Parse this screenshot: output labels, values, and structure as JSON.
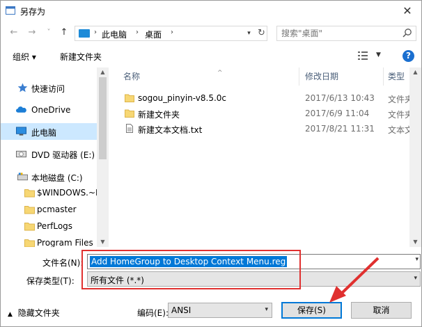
{
  "window": {
    "title": "另存为",
    "close_glyph": "✕"
  },
  "nav": {
    "back_glyph": "←",
    "forward_glyph": "→",
    "recent_glyph": "˅",
    "up_glyph": "↑",
    "breadcrumb": [
      "此电脑",
      "桌面"
    ],
    "sep_glyph": "›",
    "refresh_glyph": "↻",
    "search_placeholder": "搜索\"桌面\""
  },
  "toolbar": {
    "organize": "组织 ▾",
    "new_folder": "新建文件夹",
    "help": "?"
  },
  "sidebar": {
    "items": [
      {
        "label": "快速访问",
        "icon": "star-icon"
      },
      {
        "label": "OneDrive",
        "icon": "cloud-icon"
      },
      {
        "label": "此电脑",
        "icon": "computer-icon",
        "selected": true
      },
      {
        "label": "DVD 驱动器 (E:) (",
        "icon": "dvd-icon"
      },
      {
        "label": "本地磁盘 (C:)",
        "icon": "disk-icon"
      },
      {
        "label": "$WINDOWS.~B",
        "icon": "folder-icon"
      },
      {
        "label": "pcmaster",
        "icon": "folder-icon"
      },
      {
        "label": "PerfLogs",
        "icon": "folder-icon"
      },
      {
        "label": "Program Files",
        "icon": "folder-icon"
      }
    ]
  },
  "files": {
    "columns": {
      "name": "名称",
      "date": "修改日期",
      "type": "类型"
    },
    "rows": [
      {
        "name": "sogou_pinyin-v8.5.0c",
        "date": "2017/6/13 10:43",
        "type": "文件夹",
        "icon": "folder-icon"
      },
      {
        "name": "新建文件夹",
        "date": "2017/6/9 11:04",
        "type": "文件夹",
        "icon": "folder-icon"
      },
      {
        "name": "新建文本文档.txt",
        "date": "2017/8/21 11:31",
        "type": "文本文档",
        "icon": "text-file-icon"
      }
    ]
  },
  "form": {
    "filename_label": "文件名(N):",
    "filename_value": "Add HomeGroup to Desktop Context Menu.reg",
    "filetype_label": "保存类型(T):",
    "filetype_value": "所有文件  (*.*)",
    "hide_folders": "隐藏文件夹",
    "encoding_label": "编码(E):",
    "encoding_value": "ANSI",
    "save": "保存(S)",
    "cancel": "取消"
  },
  "colors": {
    "accent": "#0078d7",
    "highlight_box": "#e0302f",
    "selected_row": "#cce8ff"
  }
}
